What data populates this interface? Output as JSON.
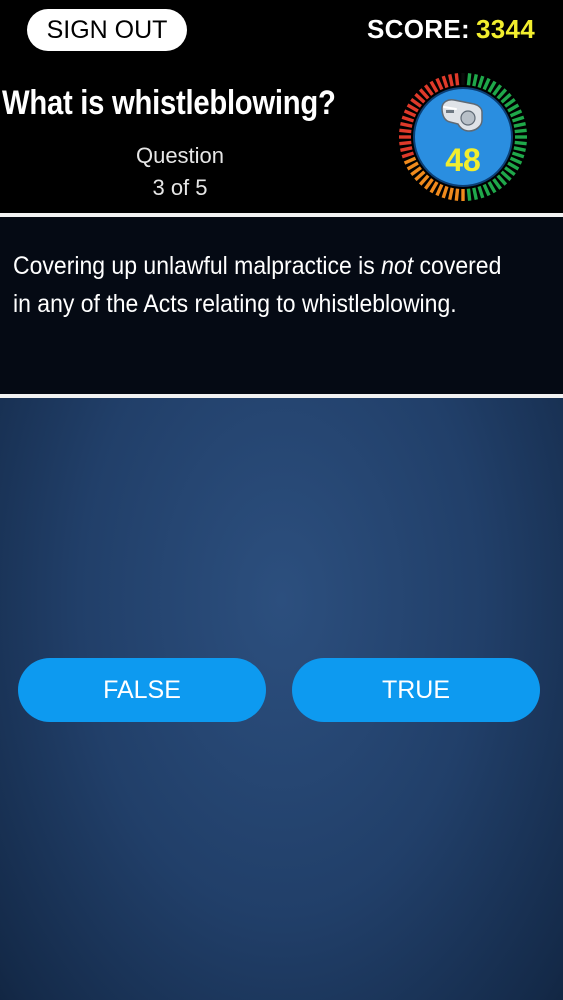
{
  "header": {
    "sign_out_label": "SIGN OUT",
    "score_label": "SCORE:",
    "score_value": "3344"
  },
  "quiz": {
    "title": "What is whistleblowing?",
    "question_label": "Question",
    "question_progress": "3 of 5",
    "timer_value": "48",
    "statement_before": "Covering up unlawful malpractice is ",
    "statement_emphasis": "not",
    "statement_after": " covered in any of the Acts relating to whistleblowing."
  },
  "answers": {
    "false_label": "FALSE",
    "true_label": "TRUE"
  },
  "colors": {
    "score_value": "#f2ee2e",
    "button": "#0d9af0",
    "timer_ring_green": "#1fa84a",
    "timer_ring_red": "#e03a2a",
    "timer_ring_orange": "#f08a1c",
    "timer_inner": "#2a8ee0"
  },
  "icons": {
    "timer_center": "whistle-icon"
  }
}
